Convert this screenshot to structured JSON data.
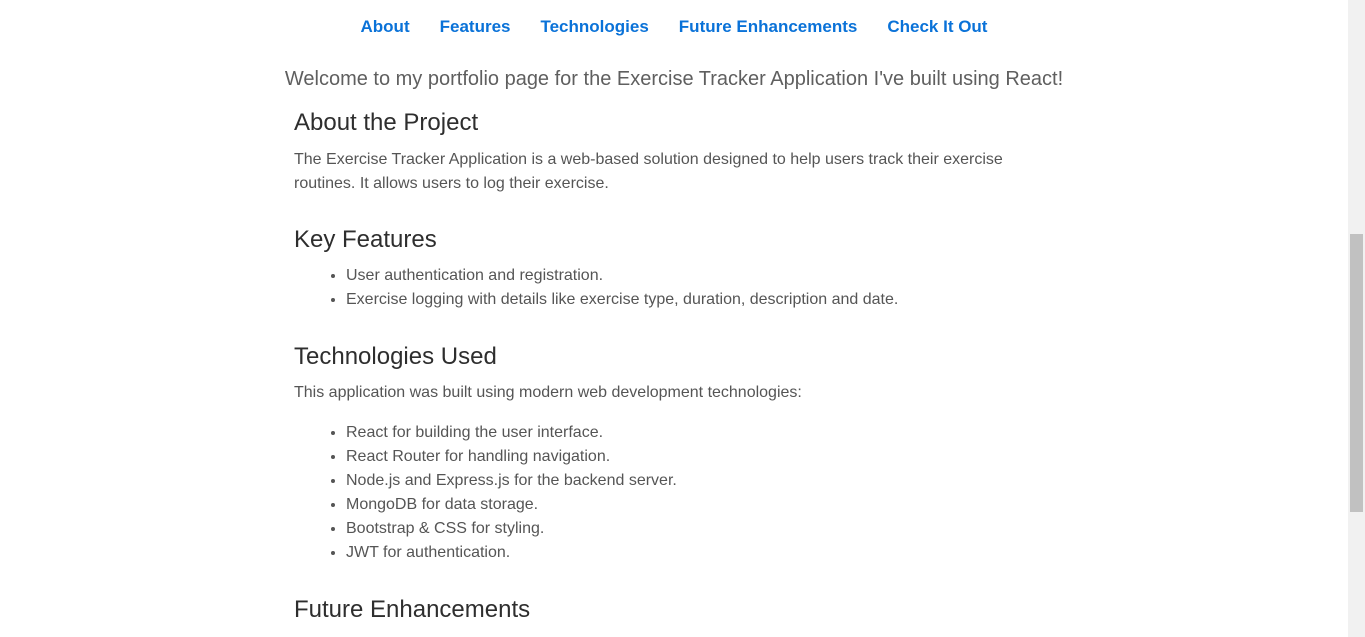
{
  "nav": {
    "items": [
      {
        "label": "About"
      },
      {
        "label": "Features"
      },
      {
        "label": "Technologies"
      },
      {
        "label": "Future Enhancements"
      },
      {
        "label": "Check It Out"
      }
    ]
  },
  "welcome": "Welcome to my portfolio page for the Exercise Tracker Application I've built using React!",
  "about": {
    "heading": "About the Project",
    "text": "The Exercise Tracker Application is a web-based solution designed to help users track their exercise routines. It allows users to log their exercise."
  },
  "features": {
    "heading": "Key Features",
    "items": [
      "User authentication and registration.",
      "Exercise logging with details like exercise type, duration, description and date."
    ]
  },
  "technologies": {
    "heading": "Technologies Used",
    "intro": "This application was built using modern web development technologies:",
    "items": [
      "React for building the user interface.",
      "React Router for handling navigation.",
      "Node.js and Express.js for the backend server.",
      "MongoDB for data storage.",
      "Bootstrap & CSS for styling.",
      "JWT for authentication."
    ]
  },
  "future": {
    "heading": "Future Enhancements"
  },
  "colors": {
    "link": "#0a72d8",
    "heading": "#2e2e2e",
    "body_text": "#555555"
  }
}
